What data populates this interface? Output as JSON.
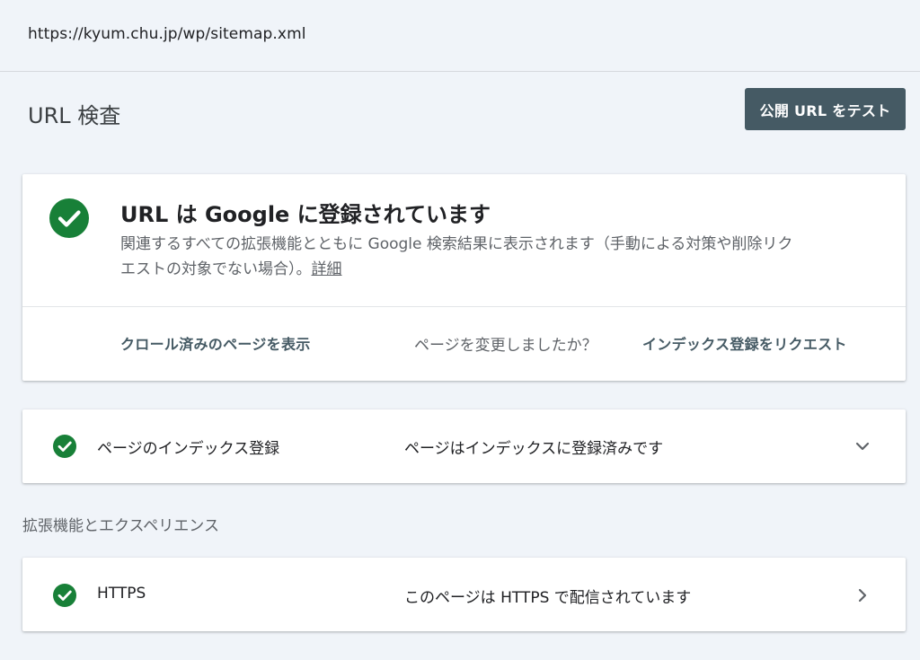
{
  "url_bar": {
    "url": "https://kyum.chu.jp/wp/sitemap.xml"
  },
  "header": {
    "title": "URL 検査",
    "test_button_label": "公開 URL をテスト"
  },
  "status_card": {
    "icon": "check-circle-icon",
    "title": "URL は Google に登録されています",
    "description": "関連するすべての拡張機能とともに Google 検索結果に表示されます（手動による対策や削除リクエストの対象でない場合）。",
    "details_link": "詳細",
    "view_crawled_label": "クロール済みのページを表示",
    "changed_question": "ページを変更しましたか？",
    "request_index_label": "インデックス登録をリクエスト"
  },
  "indexing_row": {
    "icon": "check-circle-icon",
    "label": "ページのインデックス登録",
    "value": "ページはインデックスに登録済みです",
    "chevron": "chevron-down-icon"
  },
  "enhancements": {
    "heading": "拡張機能とエクスペリエンス",
    "items": [
      {
        "icon": "check-circle-icon",
        "label": "HTTPS",
        "value": "このページは HTTPS で配信されています",
        "chevron": "chevron-right-icon"
      }
    ]
  },
  "colors": {
    "success_green": "#188038",
    "button_bg": "#455a64",
    "page_bg": "#f0f4f9"
  }
}
